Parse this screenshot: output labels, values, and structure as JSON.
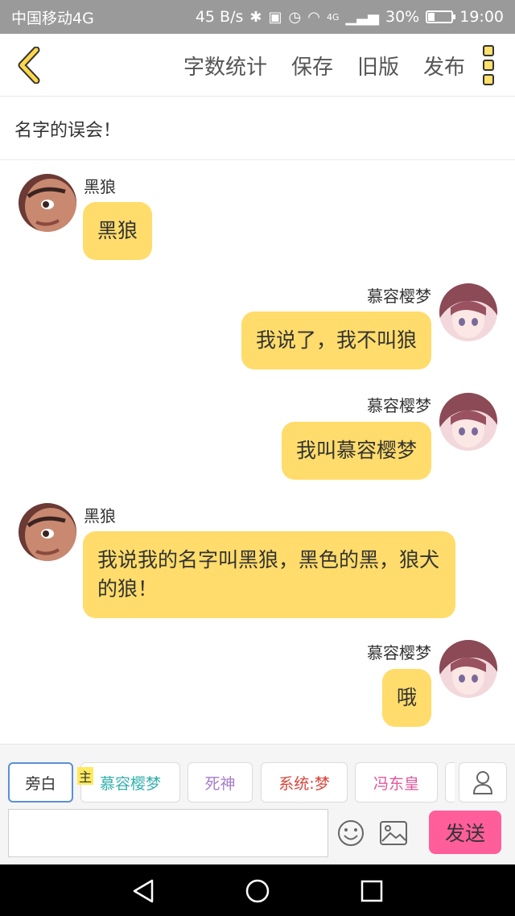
{
  "status_bar": {
    "carrier": "中国移动4G",
    "speed": "45 B/s",
    "network": "4G",
    "battery_text": "30%",
    "battery_level": 0.3,
    "time": "19:00"
  },
  "header": {
    "actions": [
      "字数统计",
      "保存",
      "旧版",
      "发布"
    ]
  },
  "title": "名字的误会！",
  "messages": [
    {
      "side": "left",
      "sender": "黑狼",
      "text": "黑狼"
    },
    {
      "side": "right",
      "sender": "慕容樱梦",
      "text": "我说了，我不叫狼"
    },
    {
      "side": "right",
      "sender": "慕容樱梦",
      "text": "我叫慕容樱梦"
    },
    {
      "side": "left",
      "sender": "黑狼",
      "text": "我说我的名字叫黑狼，黑色的黑，狼犬的狼！"
    },
    {
      "side": "right",
      "sender": "慕容樱梦",
      "text": "哦"
    }
  ],
  "roles": {
    "narration": "旁白",
    "host_tag": "主",
    "items": [
      {
        "label": "慕容樱梦",
        "color": "#35b0ad"
      },
      {
        "label": "死神",
        "color": "#a77cc8"
      },
      {
        "label": "系统:梦",
        "color": "#d9443a"
      },
      {
        "label": "冯东皇",
        "color": "#e0569a"
      }
    ]
  },
  "input": {
    "value": "",
    "placeholder": ""
  },
  "send_label": "发送",
  "colors": {
    "bubble": "#ffdc6b",
    "send": "#ff5e9a",
    "accent_back": "#ffd84a"
  },
  "icons": {
    "back": "chevron-left-icon",
    "more": "more-vertical-icon",
    "user": "user-icon",
    "emoji": "emoji-icon",
    "image": "image-icon",
    "nav_back": "triangle-back-icon",
    "nav_home": "circle-home-icon",
    "nav_recent": "square-recent-icon"
  }
}
